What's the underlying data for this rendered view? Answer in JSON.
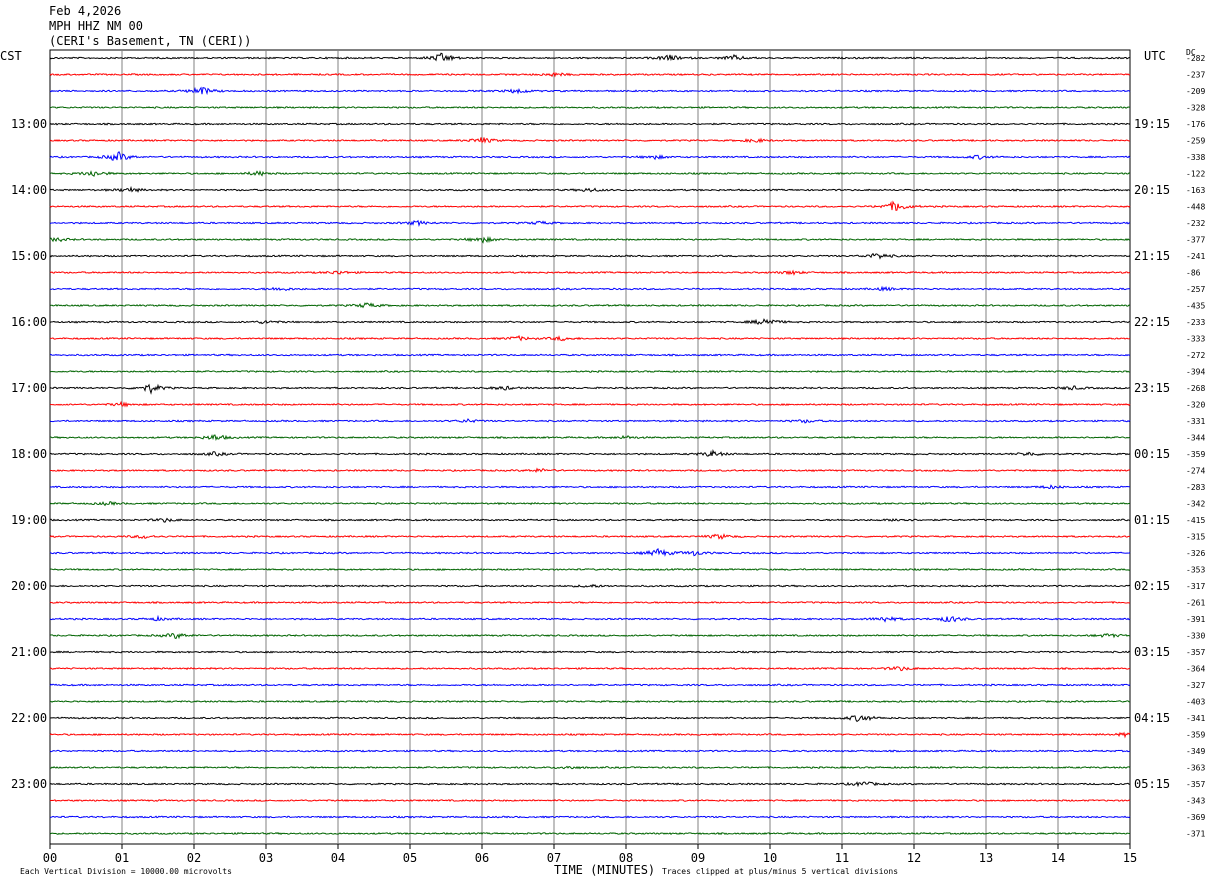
{
  "header": {
    "date": "Feb 4,2026",
    "channel": "MPH HHZ NM 00",
    "station": "(CERI's Basement, TN (CERI))"
  },
  "left_label": "CST",
  "right_label": "UTC",
  "dc_label": "DC",
  "footer": {
    "scale_note": "Each Vertical Division = 10000.00 microvolts",
    "xlabel": "TIME (MINUTES)",
    "clip_note": "Traces clipped at plus/minus 5 vertical divisions"
  },
  "colors": {
    "trace_cycle": [
      "#000000",
      "#ff0000",
      "#0000ff",
      "#006400"
    ],
    "grid": "#808080"
  },
  "chart_data": {
    "type": "line",
    "title": "Feb 4,2026  MPH HHZ NM 00  (CERI's Basement, TN (CERI))",
    "xlabel": "TIME (MINUTES)",
    "xlim": [
      0,
      15
    ],
    "xticks": [
      "00",
      "01",
      "02",
      "03",
      "04",
      "05",
      "06",
      "07",
      "08",
      "09",
      "10",
      "11",
      "12",
      "13",
      "14",
      "15"
    ],
    "trace_minutes": 15,
    "trace_count": 48,
    "left_time_labels": [
      {
        "trace": 4,
        "label": "13:00"
      },
      {
        "trace": 8,
        "label": "14:00"
      },
      {
        "trace": 12,
        "label": "15:00"
      },
      {
        "trace": 16,
        "label": "16:00"
      },
      {
        "trace": 20,
        "label": "17:00"
      },
      {
        "trace": 24,
        "label": "18:00"
      },
      {
        "trace": 28,
        "label": "19:00"
      },
      {
        "trace": 32,
        "label": "20:00"
      },
      {
        "trace": 36,
        "label": "21:00"
      },
      {
        "trace": 40,
        "label": "22:00"
      },
      {
        "trace": 44,
        "label": "23:00"
      }
    ],
    "right_time_labels": [
      {
        "trace": 4,
        "label": "19:15"
      },
      {
        "trace": 8,
        "label": "20:15"
      },
      {
        "trace": 12,
        "label": "21:15"
      },
      {
        "trace": 16,
        "label": "22:15"
      },
      {
        "trace": 20,
        "label": "23:15"
      },
      {
        "trace": 24,
        "label": "00:15"
      },
      {
        "trace": 28,
        "label": "01:15"
      },
      {
        "trace": 32,
        "label": "02:15"
      },
      {
        "trace": 36,
        "label": "03:15"
      },
      {
        "trace": 40,
        "label": "04:15"
      },
      {
        "trace": 44,
        "label": "05:15"
      }
    ],
    "dc_offsets": [
      "-282",
      "-237",
      "-209",
      "-328",
      "-176",
      "-259",
      "-338",
      "-122",
      "-163",
      "-448",
      "-232",
      "-377",
      "-241",
      "-86",
      "-257",
      "-435",
      "-233",
      "-333",
      "-272",
      "-394",
      "-268",
      "-320",
      "-331",
      "-344",
      "-359",
      "-274",
      "-283",
      "-342",
      "-415",
      "-315",
      "-326",
      "-353",
      "-317",
      "-261",
      "-391",
      "-330",
      "-357",
      "-364",
      "-327",
      "-403",
      "-341",
      "-359",
      "-349",
      "-363",
      "-357",
      "-343",
      "-369",
      "-371"
    ],
    "events": [
      {
        "trace": 0,
        "minute": 5.45,
        "amp": 1.6
      },
      {
        "trace": 0,
        "minute": 8.6,
        "amp": 1.0
      },
      {
        "trace": 0,
        "minute": 9.5,
        "amp": 0.8
      },
      {
        "trace": 1,
        "minute": 7.0,
        "amp": 0.6
      },
      {
        "trace": 2,
        "minute": 2.1,
        "amp": 1.4
      },
      {
        "trace": 2,
        "minute": 6.5,
        "amp": 0.8
      },
      {
        "trace": 5,
        "minute": 6.0,
        "amp": 1.0
      },
      {
        "trace": 5,
        "minute": 9.8,
        "amp": 0.6
      },
      {
        "trace": 6,
        "minute": 0.95,
        "amp": 1.6
      },
      {
        "trace": 6,
        "minute": 8.4,
        "amp": 0.6
      },
      {
        "trace": 6,
        "minute": 12.9,
        "amp": 0.6
      },
      {
        "trace": 7,
        "minute": 0.6,
        "amp": 1.0
      },
      {
        "trace": 7,
        "minute": 2.9,
        "amp": 0.7
      },
      {
        "trace": 8,
        "minute": 1.1,
        "amp": 0.8
      },
      {
        "trace": 8,
        "minute": 7.5,
        "amp": 0.6
      },
      {
        "trace": 9,
        "minute": 11.75,
        "amp": 1.8
      },
      {
        "trace": 10,
        "minute": 5.1,
        "amp": 0.7
      },
      {
        "trace": 10,
        "minute": 6.8,
        "amp": 0.5
      },
      {
        "trace": 11,
        "minute": 6.0,
        "amp": 1.0
      },
      {
        "trace": 11,
        "minute": 0.1,
        "amp": 0.6
      },
      {
        "trace": 12,
        "minute": 11.5,
        "amp": 1.0
      },
      {
        "trace": 13,
        "minute": 4.0,
        "amp": 0.6
      },
      {
        "trace": 13,
        "minute": 10.3,
        "amp": 0.6
      },
      {
        "trace": 14,
        "minute": 3.2,
        "amp": 0.6
      },
      {
        "trace": 14,
        "minute": 11.6,
        "amp": 0.5
      },
      {
        "trace": 15,
        "minute": 4.4,
        "amp": 0.8
      },
      {
        "trace": 16,
        "minute": 9.95,
        "amp": 1.4
      },
      {
        "trace": 16,
        "minute": 3.0,
        "amp": 0.5
      },
      {
        "trace": 17,
        "minute": 6.5,
        "amp": 0.7
      },
      {
        "trace": 17,
        "minute": 7.1,
        "amp": 0.6
      },
      {
        "trace": 20,
        "minute": 1.4,
        "amp": 1.5
      },
      {
        "trace": 20,
        "minute": 6.3,
        "amp": 0.6
      },
      {
        "trace": 20,
        "minute": 14.2,
        "amp": 0.6
      },
      {
        "trace": 21,
        "minute": 1.0,
        "amp": 0.6
      },
      {
        "trace": 22,
        "minute": 5.8,
        "amp": 0.5
      },
      {
        "trace": 22,
        "minute": 10.5,
        "amp": 0.5
      },
      {
        "trace": 23,
        "minute": 2.3,
        "amp": 1.0
      },
      {
        "trace": 23,
        "minute": 8.0,
        "amp": 0.5
      },
      {
        "trace": 24,
        "minute": 9.2,
        "amp": 1.0
      },
      {
        "trace": 24,
        "minute": 2.3,
        "amp": 0.6
      },
      {
        "trace": 24,
        "minute": 13.6,
        "amp": 0.6
      },
      {
        "trace": 25,
        "minute": 6.8,
        "amp": 0.6
      },
      {
        "trace": 26,
        "minute": 13.9,
        "amp": 0.5
      },
      {
        "trace": 27,
        "minute": 0.8,
        "amp": 0.5
      },
      {
        "trace": 28,
        "minute": 1.6,
        "amp": 0.6
      },
      {
        "trace": 28,
        "minute": 11.8,
        "amp": 0.5
      },
      {
        "trace": 29,
        "minute": 9.3,
        "amp": 0.8
      },
      {
        "trace": 29,
        "minute": 1.3,
        "amp": 0.6
      },
      {
        "trace": 30,
        "minute": 8.45,
        "amp": 1.3
      },
      {
        "trace": 30,
        "minute": 8.95,
        "amp": 0.8
      },
      {
        "trace": 32,
        "minute": 7.5,
        "amp": 0.5
      },
      {
        "trace": 34,
        "minute": 11.6,
        "amp": 0.9
      },
      {
        "trace": 34,
        "minute": 12.5,
        "amp": 1.1
      },
      {
        "trace": 34,
        "minute": 1.5,
        "amp": 0.5
      },
      {
        "trace": 35,
        "minute": 1.75,
        "amp": 0.9
      },
      {
        "trace": 35,
        "minute": 14.7,
        "amp": 0.6
      },
      {
        "trace": 37,
        "minute": 11.8,
        "amp": 0.7
      },
      {
        "trace": 40,
        "minute": 11.25,
        "amp": 1.3
      },
      {
        "trace": 41,
        "minute": 14.95,
        "amp": 0.6
      },
      {
        "trace": 43,
        "minute": 7.2,
        "amp": 0.5
      },
      {
        "trace": 44,
        "minute": 11.3,
        "amp": 0.8
      }
    ]
  }
}
